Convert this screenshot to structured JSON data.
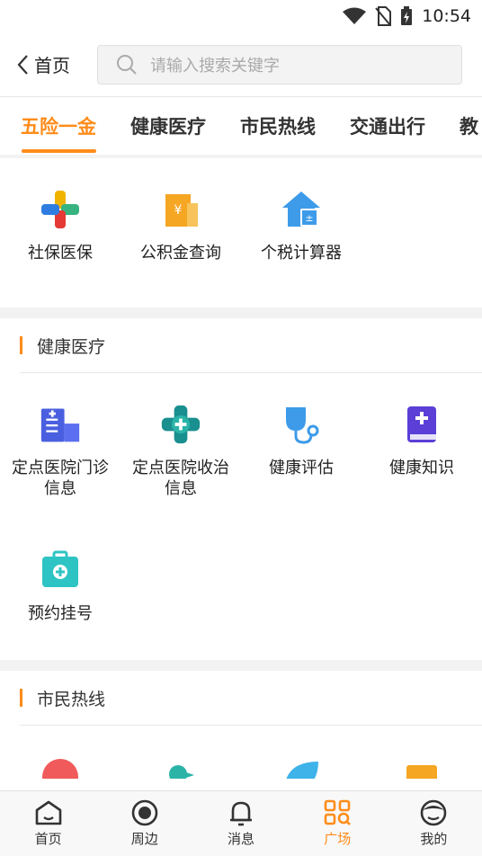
{
  "status": {
    "time": "10:54"
  },
  "header": {
    "back_label": "首页",
    "search_placeholder": "请输入搜索关键字"
  },
  "tabs": [
    "五险一金",
    "健康医疗",
    "市民热线",
    "交通出行",
    "教"
  ],
  "section1": {
    "items": [
      {
        "label": "社保医保",
        "icon": "medical-cross-icon"
      },
      {
        "label": "公积金查询",
        "icon": "building-yuan-icon"
      },
      {
        "label": "个税计算器",
        "icon": "house-calculator-icon"
      }
    ]
  },
  "section2": {
    "title": "健康医疗",
    "items": [
      {
        "label": "定点医院门诊信息",
        "icon": "hospital-icon"
      },
      {
        "label": "定点医院收治信息",
        "icon": "medical-badge-icon"
      },
      {
        "label": "健康评估",
        "icon": "stethoscope-icon"
      },
      {
        "label": "健康知识",
        "icon": "health-book-icon"
      },
      {
        "label": "预约挂号",
        "icon": "medical-kit-icon"
      }
    ]
  },
  "section3": {
    "title": "市民热线"
  },
  "tabbar": [
    {
      "label": "首页",
      "icon": "home-icon"
    },
    {
      "label": "周边",
      "icon": "location-circle-icon"
    },
    {
      "label": "消息",
      "icon": "bell-icon"
    },
    {
      "label": "广场",
      "icon": "square-grid-icon",
      "active": true
    },
    {
      "label": "我的",
      "icon": "profile-icon"
    }
  ],
  "colors": {
    "accent": "#ff8c1a"
  }
}
